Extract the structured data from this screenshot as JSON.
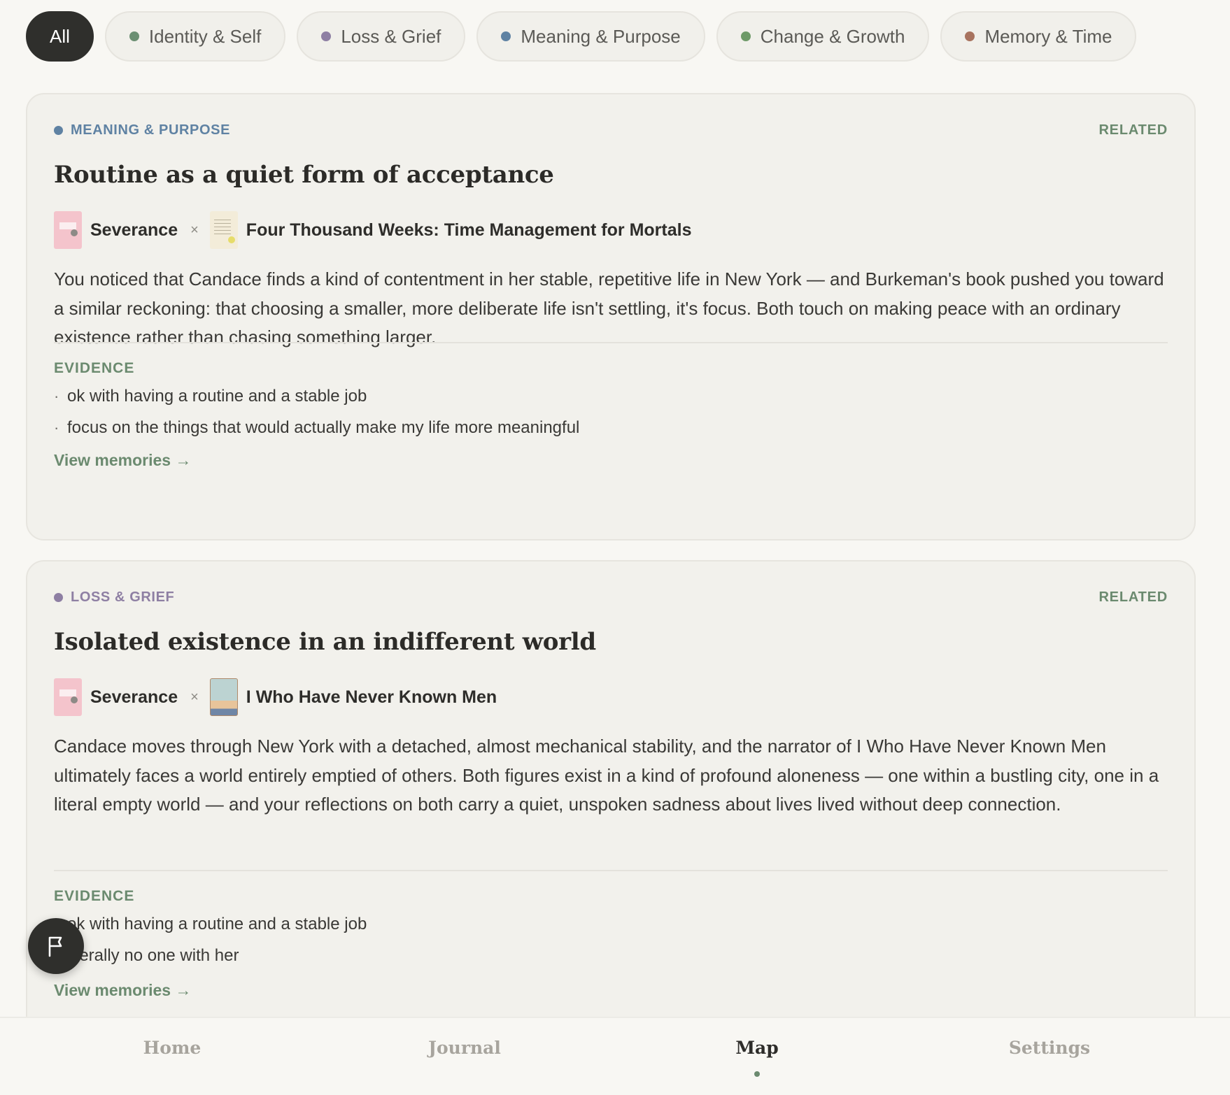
{
  "filters": [
    {
      "label": "All",
      "active": true,
      "color": ""
    },
    {
      "label": "Identity & Self",
      "active": false,
      "color": "#6b8f72"
    },
    {
      "label": "Loss & Grief",
      "active": false,
      "color": "#8e7fa3"
    },
    {
      "label": "Meaning & Purpose",
      "active": false,
      "color": "#5f82a3"
    },
    {
      "label": "Change & Growth",
      "active": false,
      "color": "#6e9a68"
    },
    {
      "label": "Memory & Time",
      "active": false,
      "color": "#a8735f"
    }
  ],
  "cards": [
    {
      "theme": "MEANING & PURPOSE",
      "theme_color": "#5f82a3",
      "related": "RELATED",
      "title": "Routine as a quiet form of acceptance",
      "media_a": {
        "name": "Severance",
        "cover": "pink-book-cover"
      },
      "separator": "×",
      "media_b": {
        "name": "Four Thousand Weeks: Time Management for Mortals",
        "cover": "cream-book-cover"
      },
      "description": "You noticed that Candace finds a kind of contentment in her stable, repetitive life in New York — and Burkeman's book pushed you toward a similar reckoning: that choosing a smaller, more deliberate life isn't settling, it's focus. Both touch on making peace with an ordinary existence rather than chasing something larger.",
      "evidence_label": "EVIDENCE",
      "evidence": [
        "ok with having a routine and a stable job",
        "focus on the things that would actually make my life more meaningful"
      ],
      "view_link": "View memories →"
    },
    {
      "theme": "LOSS & GRIEF",
      "theme_color": "#8e7fa3",
      "related": "RELATED",
      "title": "Isolated existence in an indifferent world",
      "media_a": {
        "name": "Severance",
        "cover": "pink-book-cover"
      },
      "separator": "×",
      "media_b": {
        "name": "I Who Have Never Known Men",
        "cover": "teal-book-cover"
      },
      "description": "Candace moves through New York with a detached, almost mechanical stability, and the narrator of I Who Have Never Known Men ultimately faces a world entirely emptied of others. Both figures exist in a kind of profound aloneness — one within a bustling city, one in a literal empty world — and your reflections on both carry a quiet, unspoken sadness about lives lived without deep connection.",
      "evidence_label": "EVIDENCE",
      "evidence": [
        "ok with having a routine and a stable job",
        "literally no one with her"
      ],
      "view_link": "View memories →"
    }
  ],
  "fab": {
    "icon": "flag-icon"
  },
  "nav": {
    "items": [
      "Home",
      "Journal",
      "Map",
      "Settings"
    ],
    "active": "Map"
  },
  "colors": {
    "accent": "#6b8a6f",
    "background": "#f8f7f3",
    "card": "#f2f1ec",
    "dark": "#2f2f2c"
  }
}
